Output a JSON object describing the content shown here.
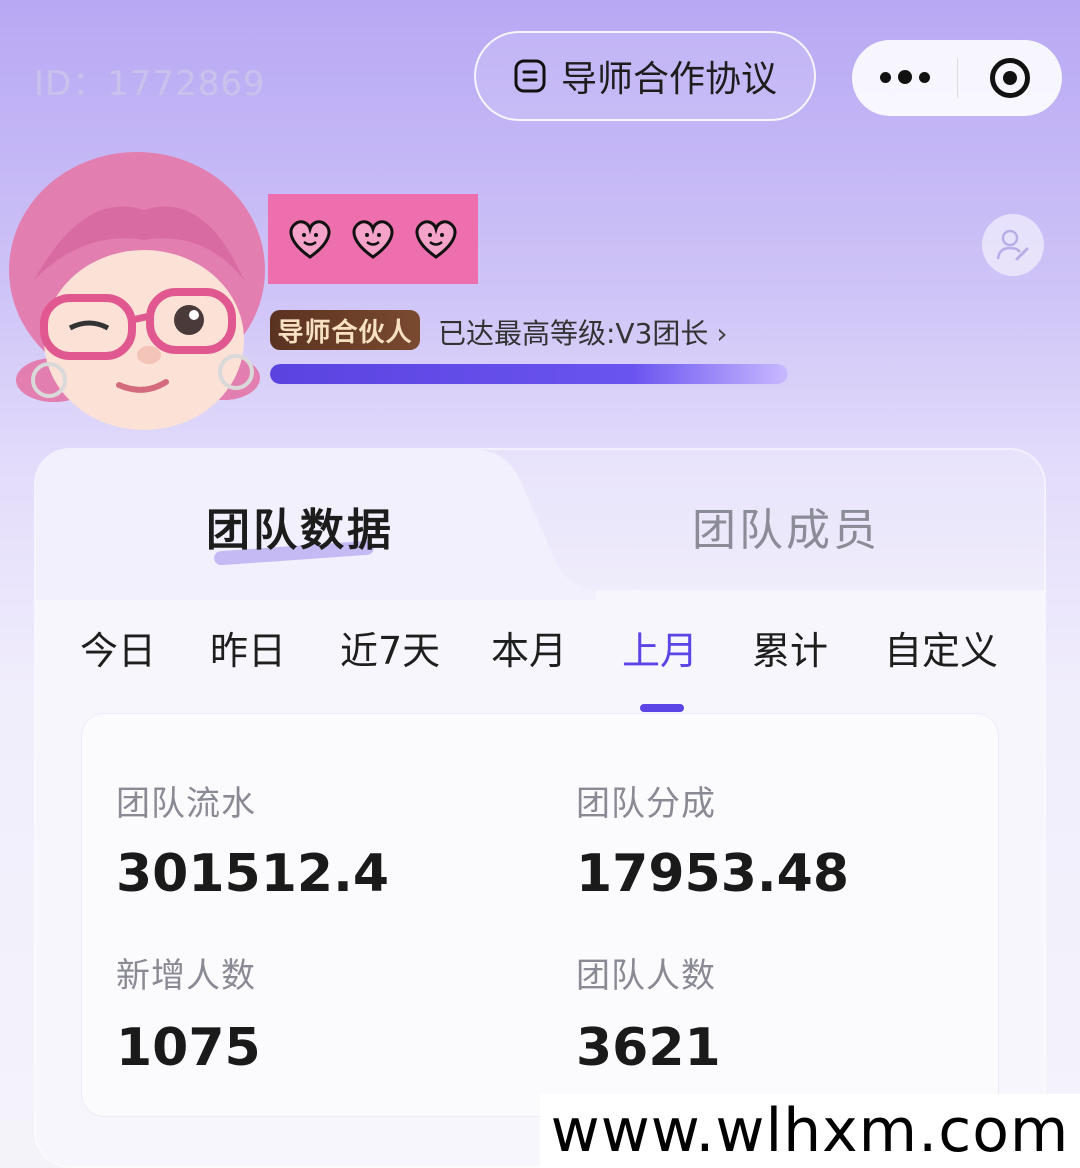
{
  "header": {
    "user_id": "ID：1772869",
    "agreement_label": "导师合作协议"
  },
  "profile": {
    "level_tag": "导师合伙人",
    "level_text": "已达最高等级:V3团长",
    "level_progress": 1.0
  },
  "tabs": [
    {
      "label": "团队数据",
      "active": true
    },
    {
      "label": "团队成员",
      "active": false
    }
  ],
  "periods": [
    {
      "label": "今日"
    },
    {
      "label": "昨日"
    },
    {
      "label": "近7天"
    },
    {
      "label": "本月"
    },
    {
      "label": "上月",
      "active": true
    },
    {
      "label": "累计"
    },
    {
      "label": "自定义"
    }
  ],
  "stats": [
    {
      "label": "团队流水",
      "value": "301512.4"
    },
    {
      "label": "团队分成",
      "value": "17953.48"
    },
    {
      "label": "新增人数",
      "value": "1075"
    },
    {
      "label": "团队人数",
      "value": "3621"
    }
  ],
  "watermark": "www.wlhxm.com",
  "colors": {
    "accent": "#5b45e6",
    "badge_pink": "#ee6fae",
    "level_tag_bg": "#5a3220"
  }
}
